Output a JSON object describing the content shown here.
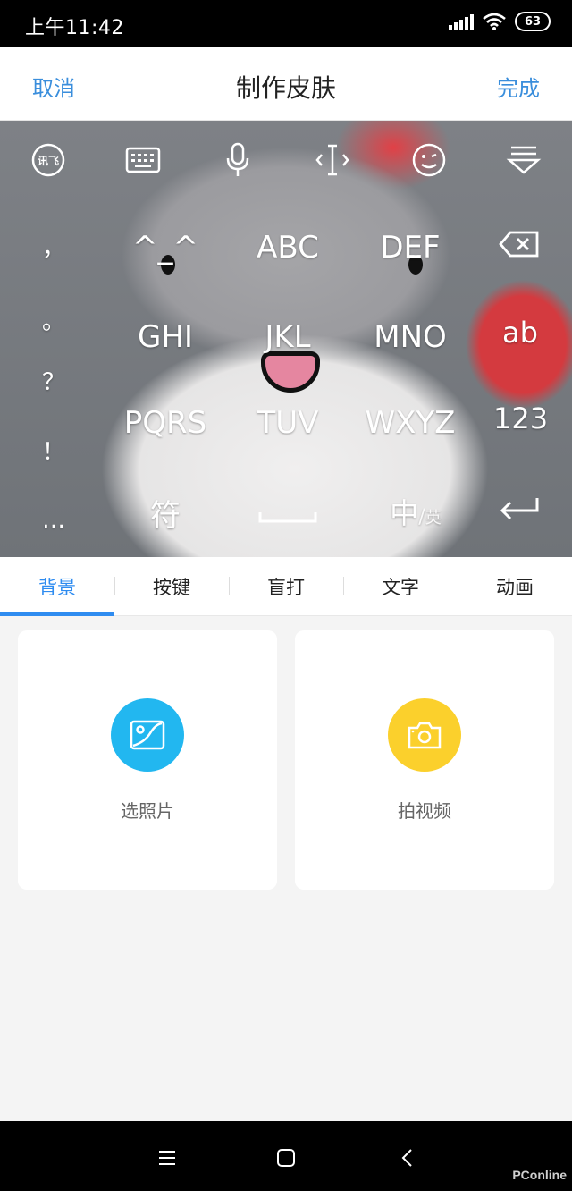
{
  "status_bar": {
    "time": "上午11:42",
    "battery": "63"
  },
  "header": {
    "cancel_label": "取消",
    "title": "制作皮肤",
    "done_label": "完成"
  },
  "keyboard_toolbar": {
    "icons": [
      "ifly-logo-icon",
      "keyboard-icon",
      "microphone-icon",
      "cursor-icon",
      "emoji-icon",
      "collapse-icon"
    ],
    "logo_text": "讯飞"
  },
  "keyboard": {
    "left_punct": [
      "，",
      "。",
      "？",
      "！",
      "…"
    ],
    "rows": [
      [
        "^_^",
        "ABC",
        "DEF"
      ],
      [
        "GHI",
        "JKL",
        "MNO"
      ],
      [
        "PQRS",
        "TUV",
        "WXYZ"
      ],
      [
        "符",
        "␣",
        "中/英"
      ]
    ],
    "right_keys": [
      "backspace-icon",
      "ab",
      "123",
      "enter-icon"
    ],
    "space_label": "",
    "symbol_label": "符",
    "lang_label_main": "中",
    "lang_label_sub": "英"
  },
  "tabs": [
    {
      "label": "背景",
      "active": true
    },
    {
      "label": "按键",
      "active": false
    },
    {
      "label": "盲打",
      "active": false
    },
    {
      "label": "文字",
      "active": false
    },
    {
      "label": "动画",
      "active": false
    }
  ],
  "cards": [
    {
      "label": "选照片",
      "icon": "photo-icon",
      "color": "#22b7f0"
    },
    {
      "label": "拍视频",
      "icon": "camera-icon",
      "color": "#fbd02c"
    }
  ],
  "nav_bar": {
    "buttons": [
      "menu-icon",
      "home-icon",
      "back-icon"
    ]
  },
  "watermark": "PConline"
}
